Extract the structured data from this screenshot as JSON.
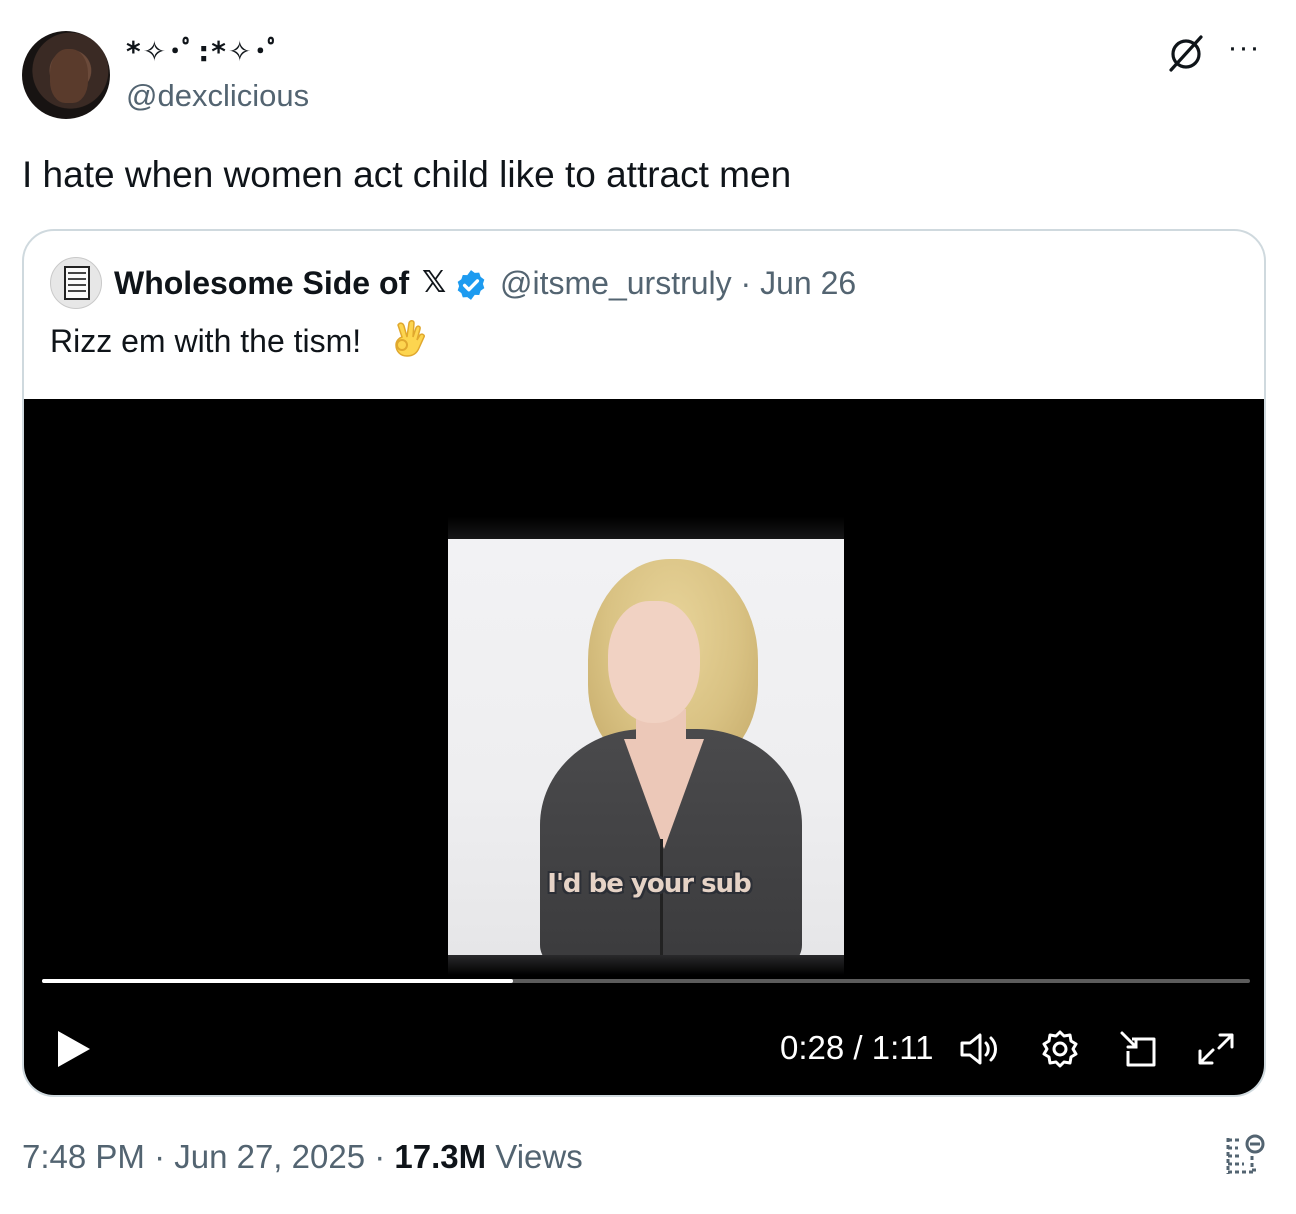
{
  "tweet": {
    "display_name": "*✧･ﾟ:*✧･ﾟ",
    "handle": "@dexclicious",
    "text": "I hate when women act child like to attract men",
    "header_icons": [
      "grok-icon",
      "more-icon"
    ],
    "more_label": "···"
  },
  "quote": {
    "name": "Wholesome Side of",
    "x_glyph": "𝕏",
    "verified": true,
    "handle_date": "@itsme_urstruly · Jun 26",
    "text": "Rizz em with the tism!",
    "emoji_icon": "ok-hand-icon",
    "accent_color": "#1d9bf0"
  },
  "video": {
    "caption": "I'd be your sub",
    "time_display": "0:28 / 1:11",
    "progress": 0.39,
    "controls": [
      "play-icon",
      "volume-icon",
      "settings-icon",
      "pip-icon",
      "fullscreen-icon"
    ]
  },
  "footer": {
    "time_date": "7:48 PM · Jun 27, 2025 · ",
    "views_count": "17.3M",
    "views_label": " Views",
    "analytics_icon": "analytics-icon"
  }
}
